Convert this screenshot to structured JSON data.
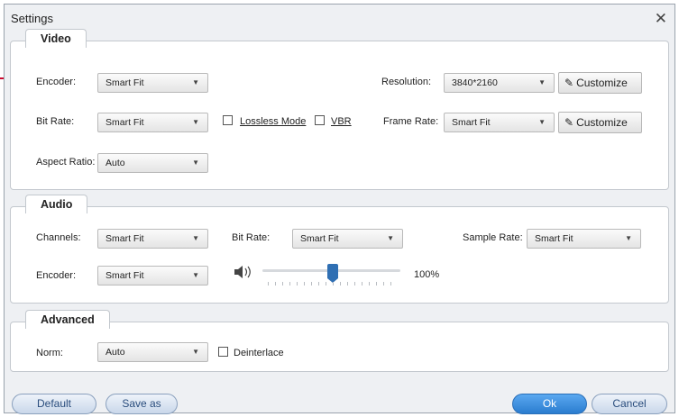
{
  "window": {
    "title": "Settings",
    "close_glyph": "✕"
  },
  "video": {
    "tab": "Video",
    "encoder_label": "Encoder:",
    "encoder_value": "Smart Fit",
    "resolution_label": "Resolution:",
    "resolution_value": "3840*2160",
    "customize_label": "Customize",
    "bitrate_label": "Bit Rate:",
    "bitrate_value": "Smart Fit",
    "lossless_label": "Lossless Mode",
    "lossless_checked": false,
    "vbr_label": "VBR",
    "vbr_checked": false,
    "framerate_label": "Frame Rate:",
    "framerate_value": "Smart Fit",
    "aspect_label": "Aspect Ratio:",
    "aspect_value": "Auto"
  },
  "audio": {
    "tab": "Audio",
    "channels_label": "Channels:",
    "channels_value": "Smart Fit",
    "bitrate_label": "Bit Rate:",
    "bitrate_value": "Smart Fit",
    "samplerate_label": "Sample Rate:",
    "samplerate_value": "Smart Fit",
    "encoder_label": "Encoder:",
    "encoder_value": "Smart Fit",
    "volume_icon": "speaker-icon",
    "volume_percent": "100%",
    "volume_level": 0.5
  },
  "advanced": {
    "tab": "Advanced",
    "norm_label": "Norm:",
    "norm_value": "Auto",
    "deinterlace_label": "Deinterlace",
    "deinterlace_checked": false
  },
  "footer": {
    "default_label": "Default",
    "saveas_label": "Save as",
    "ok_label": "Ok",
    "cancel_label": "Cancel"
  },
  "colors": {
    "accent": "#2f6fb3",
    "annotation": "#cc0a2f",
    "primary_button": "#3a8ee0"
  }
}
